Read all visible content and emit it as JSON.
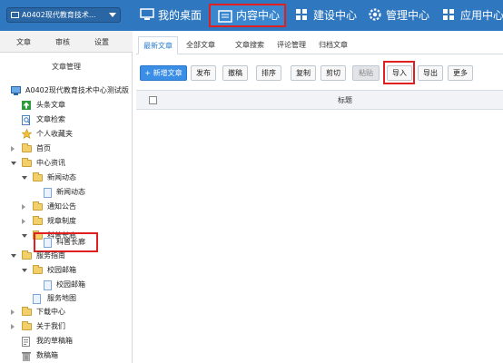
{
  "header": {
    "site_select": "A0402现代教育技术...",
    "nav": [
      {
        "label": "我的桌面",
        "icon": "desktop-icon"
      },
      {
        "label": "内容中心",
        "icon": "content-icon"
      },
      {
        "label": "建设中心",
        "icon": "grid-icon"
      },
      {
        "label": "管理中心",
        "icon": "gear-icon"
      },
      {
        "label": "应用中心",
        "icon": "apps-icon"
      }
    ]
  },
  "sidebar": {
    "tabs": [
      "文章",
      "审核",
      "设置"
    ],
    "title": "文章管理",
    "tree": [
      {
        "label": "A0402现代教育技术中心测试版",
        "icon": "monitor-icon"
      },
      {
        "label": "头条文章",
        "icon": "up-arrow-icon"
      },
      {
        "label": "文章检索",
        "icon": "search-doc-icon"
      },
      {
        "label": "个人收藏夹",
        "icon": "star-icon"
      },
      {
        "label": "首页",
        "icon": "folder-icon"
      },
      {
        "label": "中心资讯",
        "icon": "folder-icon"
      },
      {
        "label": "新闻动态",
        "icon": "folder-icon"
      },
      {
        "label": "新闻动态",
        "icon": "page-icon"
      },
      {
        "label": "通知公告",
        "icon": "folder-icon"
      },
      {
        "label": "规章制度",
        "icon": "folder-icon"
      },
      {
        "label": "科普长廊",
        "icon": "folder-icon"
      },
      {
        "label": "科普长廊",
        "icon": "page-icon"
      },
      {
        "label": "服务指南",
        "icon": "folder-icon"
      },
      {
        "label": "校园邮箱",
        "icon": "folder-icon"
      },
      {
        "label": "校园邮箱",
        "icon": "page-icon"
      },
      {
        "label": "服务地图",
        "icon": "page-icon"
      },
      {
        "label": "下载中心",
        "icon": "folder-icon"
      },
      {
        "label": "关于我们",
        "icon": "folder-icon"
      },
      {
        "label": "我的草稿箱",
        "icon": "draft-icon"
      },
      {
        "label": "数稿箱",
        "icon": "trash-icon"
      }
    ]
  },
  "main": {
    "tabs": [
      "最新文章",
      "全部文章",
      "文章搜索",
      "评论管理",
      "归档文章"
    ],
    "toolbar": [
      "+ 新增文章",
      "发布",
      "撤稿",
      "排序",
      "复制",
      "剪切",
      "粘贴",
      "导入",
      "导出",
      "更多"
    ],
    "grid": {
      "columns": [
        "标题"
      ]
    }
  },
  "colors": {
    "topbar": "#2f78bf",
    "accent": "#3a8ee6",
    "highlight": "#e02020"
  }
}
